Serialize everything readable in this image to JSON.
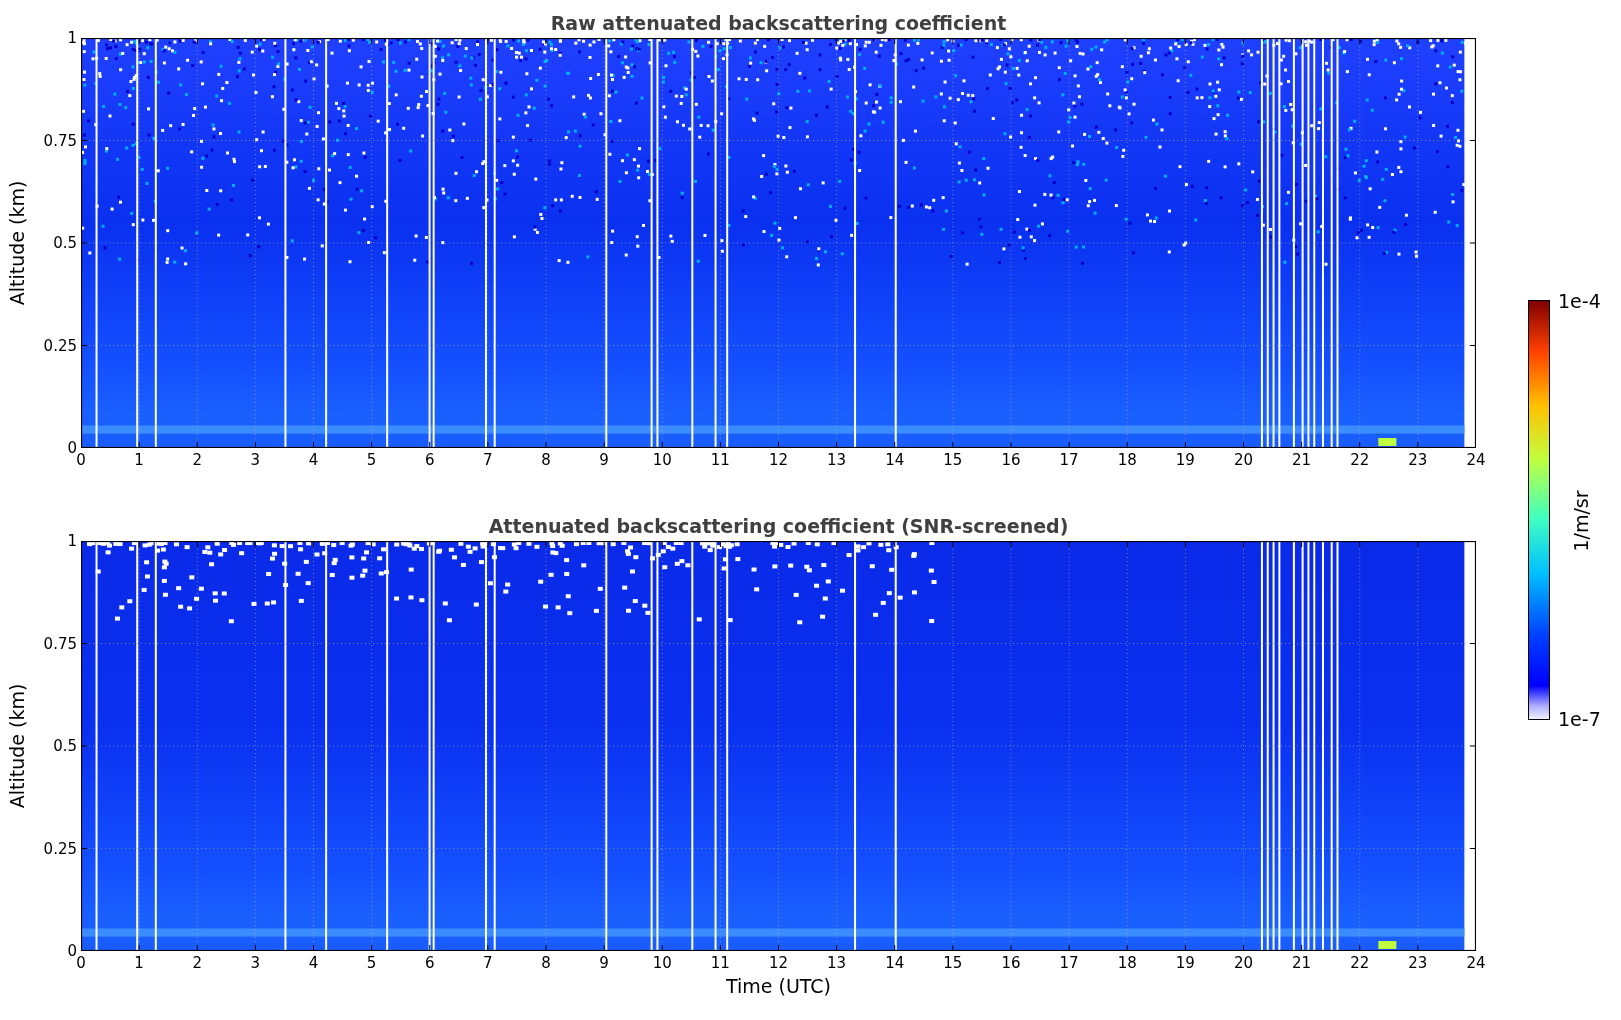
{
  "panels": [
    {
      "kind": "raw",
      "title": "Raw attenuated backscattering coefficient",
      "ylabel": "Altitude (km)",
      "yticks": [
        "1",
        "0.75",
        "0.5",
        "0.25",
        "0"
      ],
      "xticks": [
        "0",
        "1",
        "2",
        "3",
        "4",
        "5",
        "6",
        "7",
        "8",
        "9",
        "10",
        "11",
        "12",
        "13",
        "14",
        "15",
        "16",
        "17",
        "18",
        "19",
        "20",
        "21",
        "22",
        "23",
        "24"
      ]
    },
    {
      "kind": "screened",
      "title": "Attenuated backscattering coefficient (SNR-screened)",
      "ylabel": "Altitude (km)",
      "yticks": [
        "1",
        "0.75",
        "0.5",
        "0.25",
        "0"
      ],
      "xticks": [
        "0",
        "1",
        "2",
        "3",
        "4",
        "5",
        "6",
        "7",
        "8",
        "9",
        "10",
        "11",
        "12",
        "13",
        "14",
        "15",
        "16",
        "17",
        "18",
        "19",
        "20",
        "21",
        "22",
        "23",
        "24"
      ],
      "xlabel": "Time (UTC)"
    }
  ],
  "colorbar": {
    "max": "1e-4",
    "min": "1e-7",
    "label": "1/m/sr"
  }
}
